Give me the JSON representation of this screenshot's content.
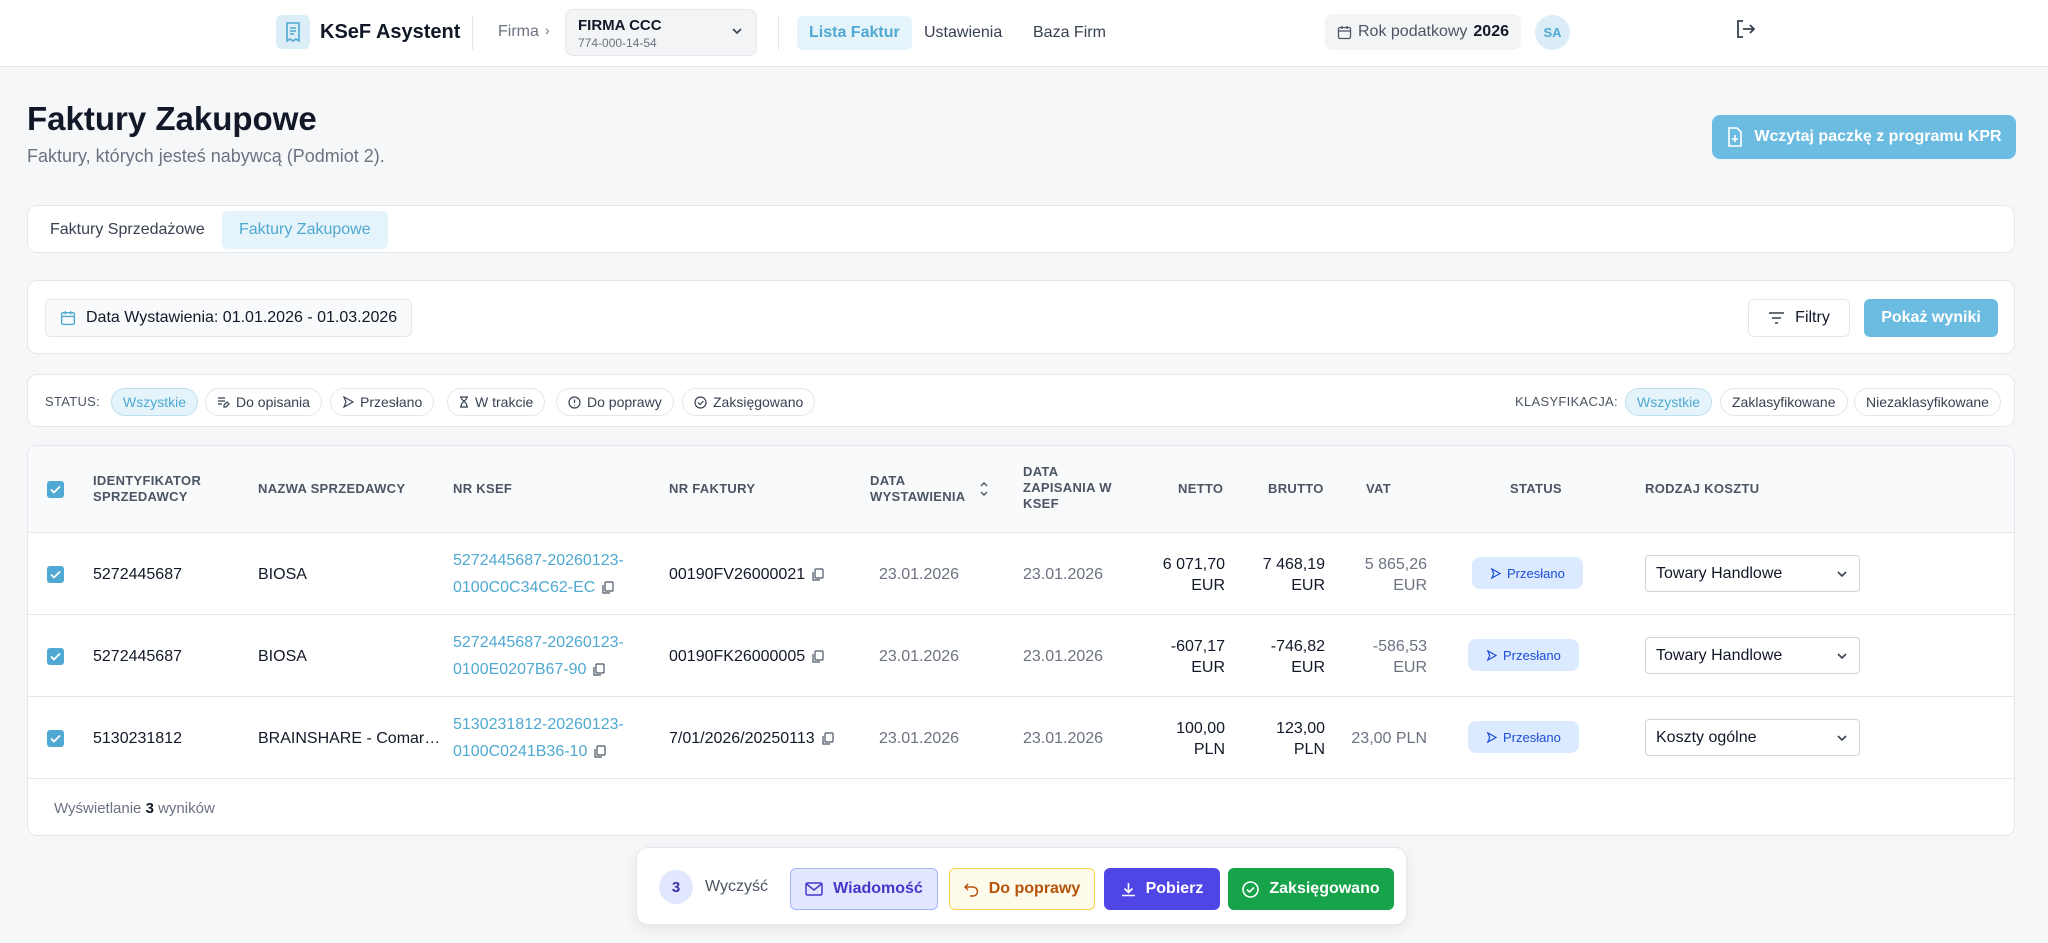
{
  "app": {
    "name": "KSeF Asystent"
  },
  "header": {
    "firma_label": "Firma",
    "firma_name": "FIRMA CCC",
    "firma_nip": "774-000-14-54",
    "nav": [
      "Lista Faktur",
      "Ustawienia",
      "Baza Firm"
    ],
    "year_label": "Rok podatkowy",
    "year_value": "2026",
    "avatar": "SA"
  },
  "page": {
    "title": "Faktury Zakupowe",
    "subtitle": "Faktury, których jesteś nabywcą (Podmiot 2).",
    "kpr_button": "Wczytaj paczkę z programu KPR"
  },
  "tabs": [
    "Faktury Sprzedażowe",
    "Faktury Zakupowe"
  ],
  "filters": {
    "date_range": "Data Wystawienia: 01.01.2026 - 01.03.2026",
    "filtry": "Filtry",
    "show_results": "Pokaż wyniki"
  },
  "status": {
    "label": "STATUS:",
    "options": [
      "Wszystkie",
      "Do opisania",
      "Przesłano",
      "W trakcie",
      "Do poprawy",
      "Zaksięgowano"
    ],
    "class_label": "KLASYFIKACJA:",
    "class_options": [
      "Wszystkie",
      "Zaklasyfikowane",
      "Niezaklasyfikowane"
    ]
  },
  "table": {
    "headers": {
      "id": [
        "IDENTYFIKATOR",
        "SPRZEDAWCY"
      ],
      "name": "NAZWA SPRZEDAWCY",
      "ksef": "NR KSEF",
      "invoice": "NR FAKTURY",
      "issued": [
        "DATA",
        "WYSTAWIENIA"
      ],
      "saved": [
        "DATA",
        "ZAPISANIA W",
        "KSEF"
      ],
      "netto": "NETTO",
      "brutto": "BRUTTO",
      "vat": "VAT",
      "status": "STATUS",
      "cost": "RODZAJ KOSZTU"
    },
    "rows": [
      {
        "seller_id": "5272445687",
        "seller": "BIOSA",
        "ksef1": "5272445687-20260123-",
        "ksef2": "0100C0C34C62-EC",
        "invoice": "00190FV26000021",
        "issued": "23.01.2026",
        "saved": "23.01.2026",
        "netto1": "6 071,70",
        "netto2": "EUR",
        "brutto1": "7 468,19",
        "brutto2": "EUR",
        "vat1": "5 865,26",
        "vat2": "EUR",
        "status": "Przesłano",
        "cost": "Towary Handlowe"
      },
      {
        "seller_id": "5272445687",
        "seller": "BIOSA",
        "ksef1": "5272445687-20260123-",
        "ksef2": "0100E0207B67-90",
        "invoice": "00190FK26000005",
        "issued": "23.01.2026",
        "saved": "23.01.2026",
        "netto1": "-607,17",
        "netto2": "EUR",
        "brutto1": "-746,82",
        "brutto2": "EUR",
        "vat1": "-586,53",
        "vat2": "EUR",
        "status": "Przesłano",
        "cost": "Towary Handlowe"
      },
      {
        "seller_id": "5130231812",
        "seller": "BRAINSHARE - Comar…",
        "ksef1": "5130231812-20260123-",
        "ksef2": "0100C0241B36-10",
        "invoice": "7/01/2026/20250113",
        "issued": "23.01.2026",
        "saved": "23.01.2026",
        "netto1": "100,00",
        "netto2": "PLN",
        "brutto1": "123,00",
        "brutto2": "PLN",
        "vat1": "23,00 PLN",
        "vat2": "",
        "status": "Przesłano",
        "cost": "Koszty ogólne"
      }
    ],
    "footer_prefix": "Wyświetlanie",
    "footer_count": "3",
    "footer_suffix": "wyników"
  },
  "actions": {
    "count": "3",
    "clear": "Wyczyść",
    "message": "Wiadomość",
    "fix": "Do poprawy",
    "download": "Pobierz",
    "booked": "Zaksięgowano"
  },
  "colors": {
    "accent": "#4fa9d2",
    "accent_light": "#6cbbe0",
    "indigo": "#4f46e5",
    "green": "#16a34a"
  }
}
